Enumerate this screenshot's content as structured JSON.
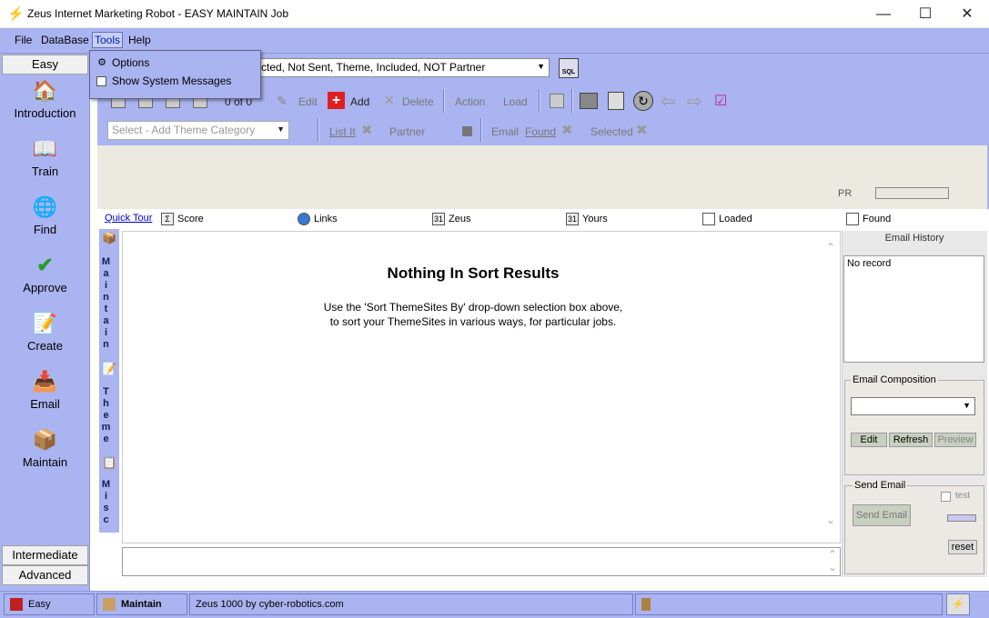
{
  "window": {
    "title": "Zeus Internet Marketing Robot - EASY MAINTAIN Job",
    "controls": [
      "minimize",
      "maximize",
      "close"
    ]
  },
  "menubar": [
    "File",
    "DataBase",
    "Tools",
    "Help"
  ],
  "tools_menu": {
    "items": [
      {
        "label": "Options",
        "icon": "options-icon"
      },
      {
        "label": "Show System Messages",
        "icon": "checkbox-icon"
      }
    ]
  },
  "left_nav": {
    "top_tab": "Easy",
    "items": [
      {
        "label": "Introduction",
        "icon": "house-icon"
      },
      {
        "label": "Train",
        "icon": "train-icon"
      },
      {
        "label": "Find",
        "icon": "globe-icon"
      },
      {
        "label": "Approve",
        "icon": "checkmark-icon"
      },
      {
        "label": "Create",
        "icon": "create-icon"
      },
      {
        "label": "Email",
        "icon": "email-icon"
      },
      {
        "label": "Maintain",
        "icon": "maintain-icon"
      }
    ],
    "bottom_tabs": [
      "Intermediate",
      "Advanced"
    ]
  },
  "toolbar1": {
    "sort_select_value": "cted, Not Sent, Theme, Included, NOT Partner",
    "sql_label": "SQL"
  },
  "toolbar2": {
    "record_counter": "0  of  0",
    "edit": "Edit",
    "add": "Add",
    "delete": "Delete",
    "action": "Action",
    "load": "Load"
  },
  "toolbar3": {
    "theme_select_placeholder": "Select - Add Theme Category",
    "list_it": "List It",
    "partner": "Partner",
    "email": "Email",
    "found": "Found",
    "selected": "Selected"
  },
  "pr_label": "PR",
  "linkbar": {
    "quick_tour": "Quick Tour",
    "score": "Score",
    "links": "Links",
    "zeus": "Zeus",
    "yours": "Yours",
    "loaded": "Loaded",
    "found": "Found"
  },
  "vertical_tabs": {
    "maintain": "Maintain",
    "theme": "Theme",
    "misc": "Misc"
  },
  "content": {
    "heading": "Nothing In Sort Results",
    "line1": "Use the 'Sort ThemeSites By' drop-down selection box above,",
    "line2": "to sort your ThemeSites in various ways, for particular jobs."
  },
  "right_panel": {
    "email_history_title": "Email History",
    "email_history_value": "No record",
    "email_composition_title": "Email Composition",
    "edit_button": "Edit",
    "refresh_button": "Refresh",
    "preview_button": "Preview",
    "send_email_title": "Send Email",
    "test_label": "test",
    "send_email_button": "Send Email",
    "reset_button": "reset"
  },
  "statusbar": {
    "level": "Easy",
    "job": "Maintain",
    "info": "Zeus 1000  by cyber-robotics.com"
  },
  "colors": {
    "chrome": "#aab4f0",
    "add_icon": "#e02020"
  }
}
